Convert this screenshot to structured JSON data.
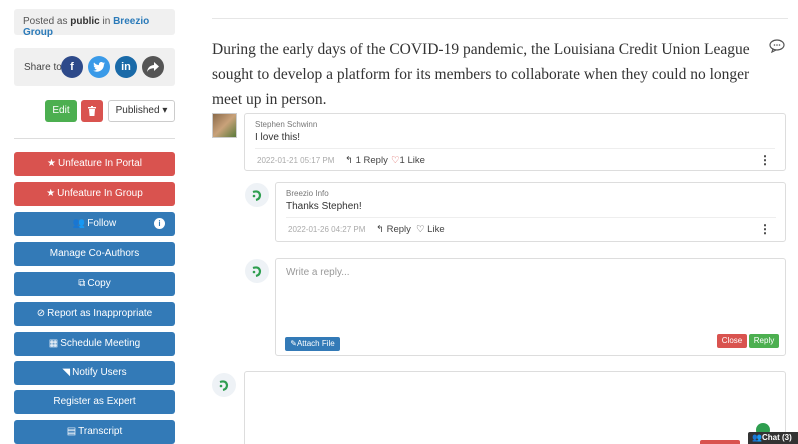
{
  "sidebar": {
    "posted": {
      "prefix": "Posted as",
      "visibility": "public",
      "in": "in",
      "group": "Breezio Group"
    },
    "share": {
      "label": "Share to",
      "icons": [
        "facebook-icon",
        "twitter-icon",
        "linkedin-icon",
        "share-icon"
      ]
    },
    "edit_label": "Edit",
    "delete_icon": "trash-icon",
    "status_select": "Published",
    "actions": [
      {
        "label": "Unfeature In Portal",
        "icon": "star-icon",
        "color": "#d9534f"
      },
      {
        "label": "Unfeature In Group",
        "icon": "star-icon",
        "color": "#d9534f"
      },
      {
        "label": "Follow",
        "icon": "users-icon",
        "color": "#337ab7"
      },
      {
        "label": "Manage Co-Authors",
        "icon": "",
        "color": "#337ab7"
      },
      {
        "label": "Copy",
        "icon": "copy-icon",
        "color": "#337ab7"
      },
      {
        "label": "Report as Inappropriate",
        "icon": "ban-icon",
        "color": "#337ab7"
      },
      {
        "label": "Schedule Meeting",
        "icon": "calendar-icon",
        "color": "#337ab7"
      },
      {
        "label": "Notify Users",
        "icon": "rss-icon",
        "color": "#337ab7"
      },
      {
        "label": "Register as Expert",
        "icon": "",
        "color": "#337ab7"
      },
      {
        "label": "Transcript",
        "icon": "file-icon",
        "color": "#337ab7"
      }
    ]
  },
  "post": {
    "text": "During the early days of the COVID-19 pandemic, the Louisiana Credit Union League sought to develop a platform for its members to collaborate when they could no longer meet up in person."
  },
  "comments": [
    {
      "author": "Stephen Schwinn",
      "text": "I love this!",
      "timestamp": "2022-01-21 05:17 PM",
      "reply_label": "1 Reply",
      "like_label": "1 Like"
    },
    {
      "author": "Breezio Info",
      "text": "Thanks Stephen!",
      "timestamp": "2022-01-26 04:27 PM",
      "reply_label": "Reply",
      "like_label": "Like"
    }
  ],
  "reply_form": {
    "placeholder": "Write a reply...",
    "attach_label": "Attach File",
    "close_label": "Close",
    "reply_label": "Reply"
  },
  "chat": {
    "label": "Chat (3)"
  },
  "colors": {
    "primary": "#337ab7",
    "danger": "#d9534f",
    "success": "#4caf50"
  }
}
